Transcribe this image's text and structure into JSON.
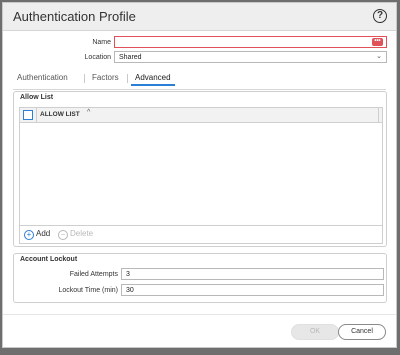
{
  "dialog": {
    "title": "Authentication Profile",
    "help_icon": "?"
  },
  "form": {
    "name": {
      "label": "Name",
      "value": "",
      "error_badge": "•••"
    },
    "location": {
      "label": "Location",
      "value": "Shared",
      "icon": "chevron-down-icon"
    }
  },
  "tabs": [
    {
      "label": "Authentication",
      "active": false
    },
    {
      "label": "Factors",
      "active": false
    },
    {
      "label": "Advanced",
      "active": true
    }
  ],
  "allow_list": {
    "legend": "Allow List",
    "column_header": "ALLOW LIST",
    "sort_icon": "^",
    "rows": [],
    "add_label": "Add",
    "delete_label": "Delete"
  },
  "account_lockout": {
    "legend": "Account Lockout",
    "failed_attempts": {
      "label": "Failed Attempts",
      "value": "3"
    },
    "lockout_time": {
      "label": "Lockout Time (min)",
      "value": "30"
    }
  },
  "footer": {
    "ok_label": "OK",
    "cancel_label": "Cancel"
  },
  "colors": {
    "accent": "#2b7fd6",
    "error": "#e0515a"
  }
}
